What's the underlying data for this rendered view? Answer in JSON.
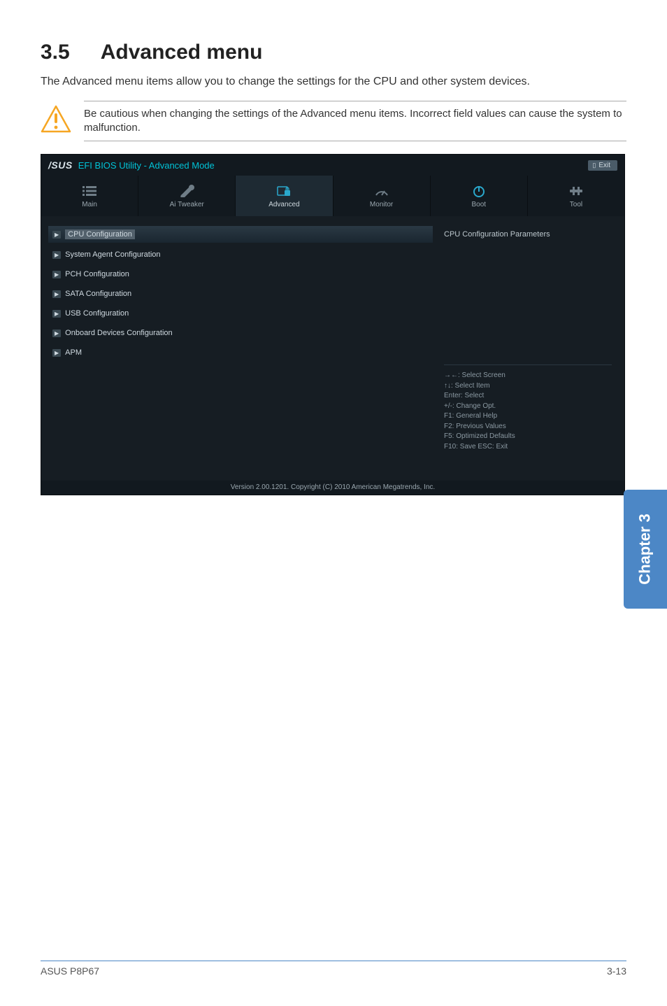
{
  "heading": {
    "number": "3.5",
    "title": "Advanced menu"
  },
  "intro": "The Advanced menu items allow you to change the settings for the CPU and other system devices.",
  "callout": {
    "message": "Be cautious when changing the settings of the Advanced menu items. Incorrect field values can cause the system to malfunction."
  },
  "bios": {
    "brand": "/SUS",
    "utility": "EFI BIOS Utility - Advanced Mode",
    "exit_label": "Exit",
    "tabs": [
      {
        "id": "main",
        "label": "Main",
        "icon": "list-icon",
        "active": false
      },
      {
        "id": "ai",
        "label": "Ai  Tweaker",
        "icon": "wrench-icon",
        "active": false
      },
      {
        "id": "advanced",
        "label": "Advanced",
        "icon": "chip-lock-icon",
        "active": true
      },
      {
        "id": "monitor",
        "label": "Monitor",
        "icon": "gauge-icon",
        "active": false
      },
      {
        "id": "boot",
        "label": "Boot",
        "icon": "power-icon",
        "active": false
      },
      {
        "id": "tool",
        "label": "Tool",
        "icon": "tool-icon",
        "active": false
      }
    ],
    "menu": [
      {
        "label": "CPU Configuration",
        "selected": true
      },
      {
        "label": "System Agent Configuration",
        "selected": false
      },
      {
        "label": "PCH Configuration",
        "selected": false
      },
      {
        "label": "SATA Configuration",
        "selected": false
      },
      {
        "label": "USB Configuration",
        "selected": false
      },
      {
        "label": "Onboard Devices Configuration",
        "selected": false
      },
      {
        "label": "APM",
        "selected": false
      }
    ],
    "side_title": "CPU Configuration Parameters",
    "help": [
      "→←:  Select Screen",
      "↑↓:  Select Item",
      "Enter:  Select",
      "+/-:  Change Opt.",
      "F1:  General Help",
      "F2:  Previous Values",
      "F5:  Optimized Defaults",
      "F10:  Save   ESC:  Exit"
    ],
    "footer": "Version  2.00.1201.   Copyright  (C)  2010  American  Megatrends,  Inc."
  },
  "side_tab": "Chapter 3",
  "page_footer": {
    "left": "ASUS P8P67",
    "right": "3-13"
  }
}
